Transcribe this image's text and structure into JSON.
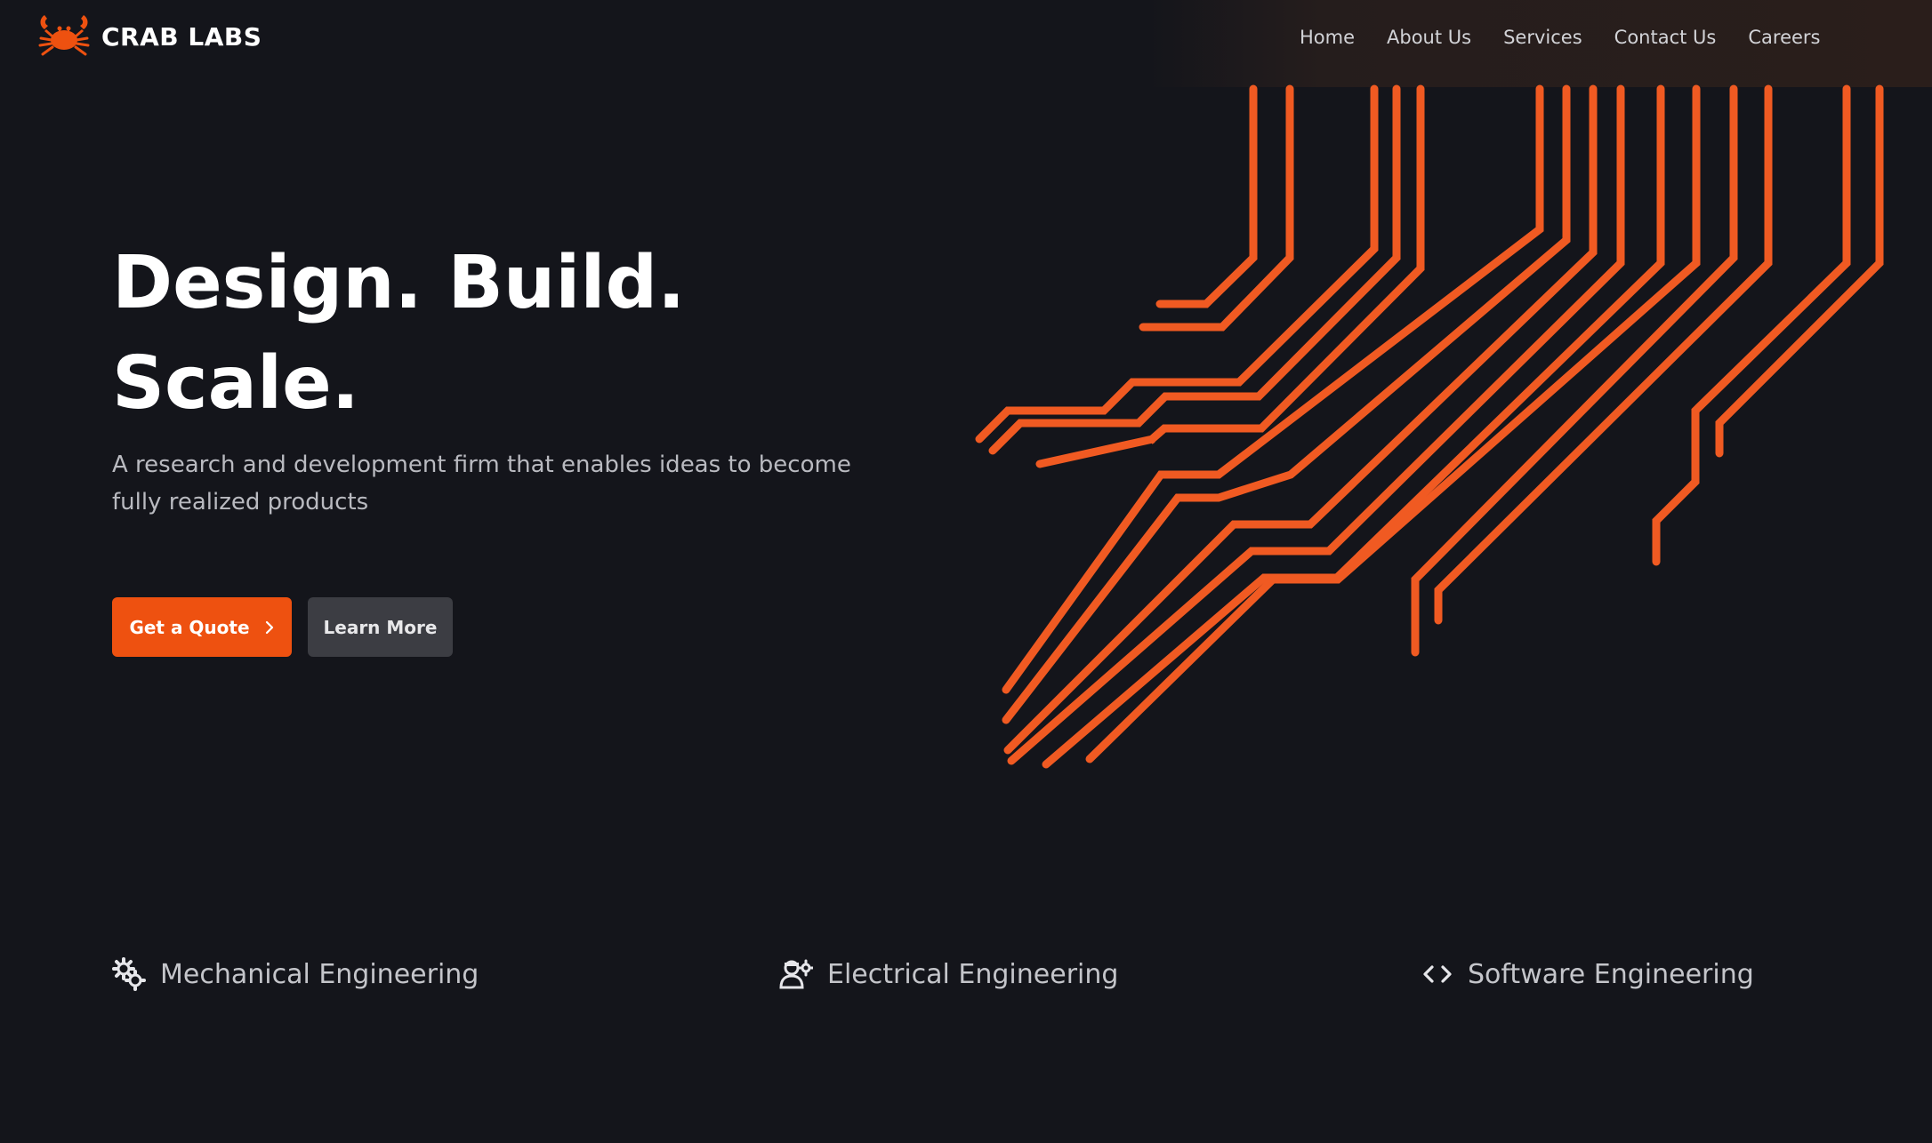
{
  "brand": {
    "name": "CRAB LABS",
    "logo_icon": "crab-icon",
    "accent_color": "#ee5110"
  },
  "nav": {
    "items": [
      {
        "label": "Home"
      },
      {
        "label": "About Us"
      },
      {
        "label": "Services"
      },
      {
        "label": "Contact Us"
      },
      {
        "label": "Careers"
      }
    ]
  },
  "hero": {
    "title_line1": "Design. Build.",
    "title_line2": "Scale.",
    "subtitle": "A research and development firm that enables ideas to become fully realized products",
    "primary_button": {
      "label": "Get a Quote",
      "icon": "chevron-right-icon"
    },
    "secondary_button": {
      "label": "Learn More"
    },
    "decoration": "circuit-traces"
  },
  "features": [
    {
      "label": "Mechanical Engineering",
      "icon": "gears-icon"
    },
    {
      "label": "Electrical Engineering",
      "icon": "engineer-gear-icon"
    },
    {
      "label": "Software Engineering",
      "icon": "code-brackets-icon"
    }
  ]
}
